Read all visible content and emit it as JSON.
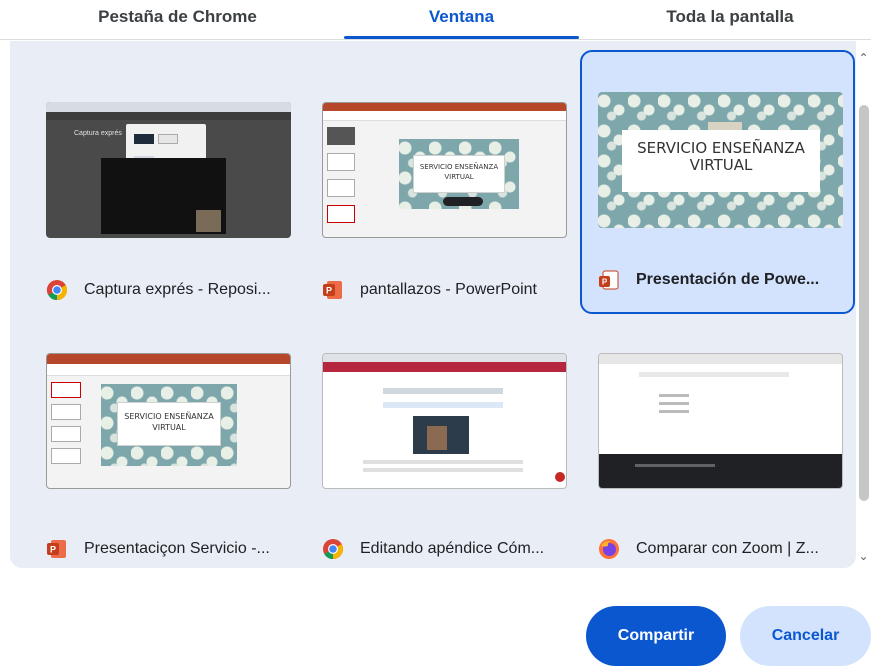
{
  "tabs": [
    {
      "label": "Pestaña de Chrome",
      "active": false
    },
    {
      "label": "Ventana",
      "active": true
    },
    {
      "label": "Toda la pantalla",
      "active": false
    }
  ],
  "windows": [
    {
      "title": "Captura exprés - Reposi...",
      "app_icon": "chrome-icon",
      "selected": false,
      "thumb_text": "Captura exprés"
    },
    {
      "title": "pantallazos - PowerPoint",
      "app_icon": "powerpoint-icon",
      "selected": false,
      "thumb_text": "SERVICIO ENSEÑANZA VIRTUAL"
    },
    {
      "title": "Presentación de Powe...",
      "app_icon": "powerpoint-icon",
      "selected": true,
      "thumb_text": "SERVICIO ENSEÑANZA VIRTUAL"
    },
    {
      "title": "Presentaciçon Servicio -...",
      "app_icon": "powerpoint-icon",
      "selected": false,
      "thumb_text": "SERVICIO ENSEÑANZA VIRTUAL"
    },
    {
      "title": "Editando apéndice Cóm...",
      "app_icon": "chrome-icon",
      "selected": false,
      "thumb_text": ""
    },
    {
      "title": "Comparar con Zoom | Z...",
      "app_icon": "firefox-icon",
      "selected": false,
      "thumb_text": ""
    }
  ],
  "buttons": {
    "share_label": "Compartir",
    "cancel_label": "Cancelar"
  },
  "colors": {
    "accent": "#0b57d0",
    "selected_bg": "#d3e3fd",
    "grid_bg": "#e9eef6"
  }
}
